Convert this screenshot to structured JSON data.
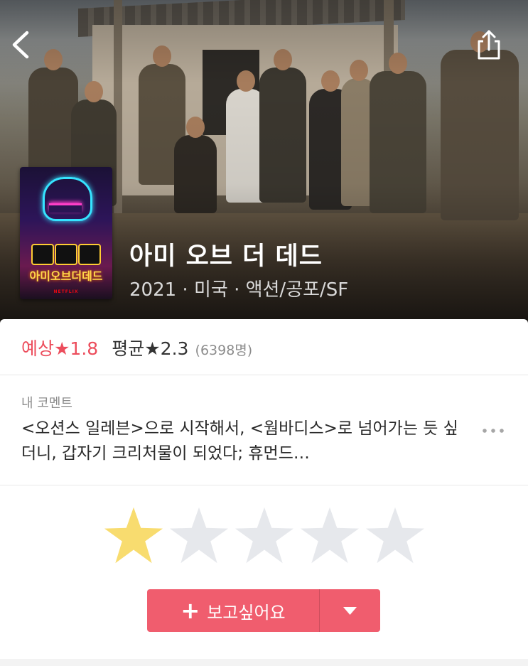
{
  "header": {
    "back_icon": "chevron-left-icon",
    "share_icon": "share-icon"
  },
  "movie": {
    "title": "아미 오브 더 데드",
    "meta": "2021 · 미국 · 액션/공포/SF",
    "poster": {
      "title_text": "아미오브더데드",
      "footer_text": "NETFLIX"
    }
  },
  "ratings": {
    "expected_label": "예상★1.8",
    "average_label": "평균★2.3",
    "count_label": "(6398명)"
  },
  "comment": {
    "label": "내 코멘트",
    "text": "<오션스 일레븐>으로 시작해서, <웜바디스>로 넘어가는 듯 싶더니, 갑자기 크리처물이 되었다; 휴먼드…",
    "more_icon": "more-icon"
  },
  "user_rating": {
    "value": 1,
    "max": 5,
    "filled_color": "#f8dc6f",
    "empty_color": "#e6e8ec"
  },
  "wishlist_button": {
    "label": "보고싶어요",
    "plus_icon": "plus-icon",
    "dropdown_icon": "caret-down-icon",
    "color": "#f05d6e"
  }
}
